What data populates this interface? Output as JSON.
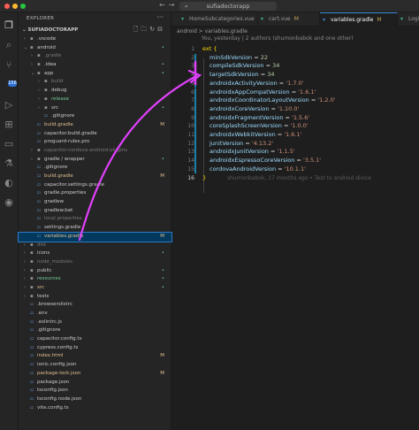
{
  "titlebar": {
    "search_text": "sufiadoctorapp",
    "colors": {
      "close": "#ff5f57",
      "minimize": "#febc2e",
      "maximize": "#28c840"
    }
  },
  "activity": {
    "items": [
      "files-icon",
      "search-icon",
      "source-control-icon",
      "run-debug-icon",
      "extensions-icon",
      "remote-explorer-icon",
      "testing-icon",
      "docker-icon",
      "gitlens-icon",
      "timeline-icon"
    ],
    "source_control_badge": "156"
  },
  "sidebar": {
    "header": "EXPLORER",
    "section": "SUFIADOCTORAPP",
    "rows": [
      {
        "label": ".vscode",
        "depth": 0,
        "kind": "folder",
        "open": false,
        "color": "#cccccc",
        "badge": ""
      },
      {
        "label": "android",
        "depth": 0,
        "kind": "folder",
        "open": true,
        "color": "#cccccc",
        "badge": "dot"
      },
      {
        "label": ".gradle",
        "depth": 1,
        "kind": "folder",
        "open": false,
        "color": "#7a7a7a",
        "badge": ""
      },
      {
        "label": ".idea",
        "depth": 1,
        "kind": "folder",
        "open": false,
        "color": "#cccccc",
        "badge": "dot"
      },
      {
        "label": "app",
        "depth": 1,
        "kind": "folder",
        "open": true,
        "color": "#cccccc",
        "badge": "dot"
      },
      {
        "label": "build",
        "depth": 2,
        "kind": "folder",
        "open": false,
        "color": "#7a7a7a",
        "badge": ""
      },
      {
        "label": "debug",
        "depth": 2,
        "kind": "folder",
        "open": false,
        "color": "#cccccc",
        "badge": ""
      },
      {
        "label": "release",
        "depth": 2,
        "kind": "folder",
        "open": false,
        "color": "#73c991",
        "badge": "dot"
      },
      {
        "label": "src",
        "depth": 2,
        "kind": "folder",
        "open": false,
        "color": "#cccccc",
        "badge": "dot"
      },
      {
        "label": ".gitignore",
        "depth": 2,
        "kind": "file",
        "color": "#cccccc",
        "badge": ""
      },
      {
        "label": "build.gradle",
        "depth": 1,
        "kind": "file",
        "color": "#e2c08d",
        "badge": "M"
      },
      {
        "label": "capacitor.build.gradle",
        "depth": 1,
        "kind": "file",
        "color": "#cccccc",
        "badge": ""
      },
      {
        "label": "proguard-rules.pro",
        "depth": 1,
        "kind": "file",
        "color": "#cccccc",
        "badge": ""
      },
      {
        "label": "capacitor-cordova-android-plugins",
        "depth": 1,
        "kind": "folder",
        "open": false,
        "color": "#7a7a7a",
        "badge": ""
      },
      {
        "label": "gradle / wrapper",
        "depth": 1,
        "kind": "folder",
        "open": false,
        "color": "#cccccc",
        "badge": "dot"
      },
      {
        "label": ".gitignore",
        "depth": 1,
        "kind": "file",
        "color": "#cccccc",
        "badge": ""
      },
      {
        "label": "build.gradle",
        "depth": 1,
        "kind": "file",
        "color": "#e2c08d",
        "badge": "M"
      },
      {
        "label": "capacitor.settings.gradle",
        "depth": 1,
        "kind": "file",
        "color": "#cccccc",
        "badge": ""
      },
      {
        "label": "gradle.properties",
        "depth": 1,
        "kind": "file",
        "color": "#cccccc",
        "badge": ""
      },
      {
        "label": "gradlew",
        "depth": 1,
        "kind": "file",
        "color": "#cccccc",
        "badge": ""
      },
      {
        "label": "gradlew.bat",
        "depth": 1,
        "kind": "file",
        "color": "#cccccc",
        "badge": ""
      },
      {
        "label": "local.properties",
        "depth": 1,
        "kind": "file",
        "color": "#7a7a7a",
        "badge": ""
      },
      {
        "label": "settings.gradle",
        "depth": 1,
        "kind": "file",
        "color": "#cccccc",
        "badge": ""
      },
      {
        "label": "variables.gradle",
        "depth": 1,
        "kind": "file",
        "color": "#e2c08d",
        "badge": "M",
        "selected": true
      },
      {
        "label": "dist",
        "depth": 0,
        "kind": "folder",
        "open": false,
        "color": "#7a7a7a",
        "badge": ""
      },
      {
        "label": "icons",
        "depth": 0,
        "kind": "folder",
        "open": false,
        "color": "#cccccc",
        "badge": "dot"
      },
      {
        "label": "node_modules",
        "depth": 0,
        "kind": "folder",
        "open": false,
        "color": "#7a7a7a",
        "badge": ""
      },
      {
        "label": "public",
        "depth": 0,
        "kind": "folder",
        "open": false,
        "color": "#cccccc",
        "badge": "dot"
      },
      {
        "label": "resources",
        "depth": 0,
        "kind": "folder",
        "open": false,
        "color": "#73c991",
        "badge": "dot"
      },
      {
        "label": "src",
        "depth": 0,
        "kind": "folder",
        "open": false,
        "color": "#e2c08d",
        "badge": "dot"
      },
      {
        "label": "tests",
        "depth": 0,
        "kind": "folder",
        "open": false,
        "color": "#cccccc",
        "badge": ""
      },
      {
        "label": ".browserslistrc",
        "depth": 0,
        "kind": "file",
        "color": "#cccccc",
        "badge": ""
      },
      {
        "label": ".env",
        "depth": 0,
        "kind": "file",
        "color": "#cccccc",
        "badge": ""
      },
      {
        "label": ".eslintrc.js",
        "depth": 0,
        "kind": "file",
        "color": "#cccccc",
        "badge": ""
      },
      {
        "label": ".gitignore",
        "depth": 0,
        "kind": "file",
        "color": "#cccccc",
        "badge": ""
      },
      {
        "label": "capacitor.config.ts",
        "depth": 0,
        "kind": "file",
        "color": "#cccccc",
        "badge": ""
      },
      {
        "label": "cypress.config.ts",
        "depth": 0,
        "kind": "file",
        "color": "#cccccc",
        "badge": ""
      },
      {
        "label": "index.html",
        "depth": 0,
        "kind": "file",
        "color": "#e2c08d",
        "badge": "M"
      },
      {
        "label": "ionic.config.json",
        "depth": 0,
        "kind": "file",
        "color": "#cccccc",
        "badge": ""
      },
      {
        "label": "package-lock.json",
        "depth": 0,
        "kind": "file",
        "color": "#e2c08d",
        "badge": "M"
      },
      {
        "label": "package.json",
        "depth": 0,
        "kind": "file",
        "color": "#cccccc",
        "badge": ""
      },
      {
        "label": "tsconfig.json",
        "depth": 0,
        "kind": "file",
        "color": "#cccccc",
        "badge": ""
      },
      {
        "label": "tsconfig.node.json",
        "depth": 0,
        "kind": "file",
        "color": "#cccccc",
        "badge": ""
      },
      {
        "label": "vite.config.ts",
        "depth": 0,
        "kind": "file",
        "color": "#cccccc",
        "badge": ""
      }
    ]
  },
  "tabs": [
    {
      "label": "HomeSubcategories.vue",
      "modified": "M",
      "active": false
    },
    {
      "label": "cart.vue",
      "modified": "M",
      "active": false
    },
    {
      "label": "variables.gradle",
      "modified": "M",
      "active": true
    },
    {
      "label": "Login.vu",
      "modified": "",
      "active": false
    }
  ],
  "breadcrumb": "android  >  variables.gradle",
  "editor": {
    "blame_header": "You, yesterday | 2 authors (shumonbabok and one other)",
    "inline_blame": "shumonbabok, 17 months ago • Test to android divice",
    "lines": [
      {
        "n": "1",
        "text": "ext {"
      },
      {
        "n": "2",
        "key": "minSdkVersion",
        "value": "22"
      },
      {
        "n": "3",
        "key": "compileSdkVersion",
        "value": "34"
      },
      {
        "n": "4",
        "key": "targetSdkVersion",
        "value": "34"
      },
      {
        "n": "5",
        "key": "androidxActivityVersion",
        "value": "'1.7.0'"
      },
      {
        "n": "6",
        "key": "androidxAppCompatVersion",
        "value": "'1.6.1'"
      },
      {
        "n": "7",
        "key": "androidxCoordinatorLayoutVersion",
        "value": "'1.2.0'"
      },
      {
        "n": "8",
        "key": "androidxCoreVersion",
        "value": "'1.10.0'"
      },
      {
        "n": "9",
        "key": "androidxFragmentVersion",
        "value": "'1.5.6'"
      },
      {
        "n": "10",
        "key": "coreSplashScreenVersion",
        "value": "'1.0.0'"
      },
      {
        "n": "11",
        "key": "androidxWebkitVersion",
        "value": "'1.6.1'"
      },
      {
        "n": "12",
        "key": "junitVersion",
        "value": "'4.13.2'"
      },
      {
        "n": "13",
        "key": "androidxJunitVersion",
        "value": "'1.1.5'"
      },
      {
        "n": "14",
        "key": "androidxEspressoCoreVersion",
        "value": "'3.5.1'"
      },
      {
        "n": "15",
        "key": "cordovaAndroidVersion",
        "value": "'10.1.1'"
      },
      {
        "n": "16",
        "text": "}"
      }
    ]
  },
  "annotation_color": "#e040fb"
}
